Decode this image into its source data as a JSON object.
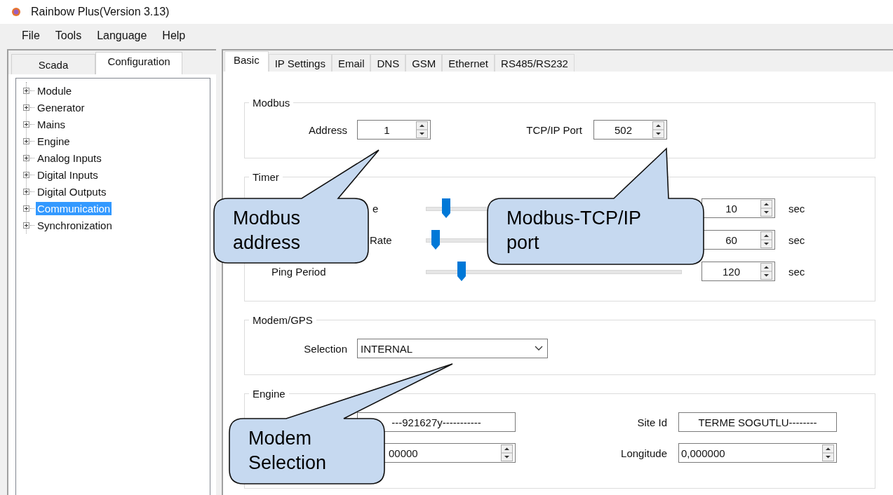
{
  "window": {
    "title": "Rainbow Plus(Version 3.13)"
  },
  "menu": [
    "File",
    "Tools",
    "Language",
    "Help"
  ],
  "left_tabs": [
    {
      "label": "Scada",
      "selected": false
    },
    {
      "label": "Configuration",
      "selected": true
    }
  ],
  "tree": [
    {
      "label": "Module",
      "expanded": false,
      "selected": false
    },
    {
      "label": "Generator",
      "expanded": false,
      "selected": false
    },
    {
      "label": "Mains",
      "expanded": false,
      "selected": false
    },
    {
      "label": "Engine",
      "expanded": false,
      "selected": false
    },
    {
      "label": "Analog Inputs",
      "expanded": false,
      "selected": false
    },
    {
      "label": "Digital Inputs",
      "expanded": false,
      "selected": false
    },
    {
      "label": "Digital Outputs",
      "expanded": false,
      "selected": false
    },
    {
      "label": "Communication",
      "expanded": false,
      "selected": true
    },
    {
      "label": "Synchronization",
      "expanded": false,
      "selected": false
    }
  ],
  "tabs": [
    {
      "label": "Basic",
      "selected": true
    },
    {
      "label": "IP Settings",
      "selected": false
    },
    {
      "label": "Email",
      "selected": false
    },
    {
      "label": "DNS",
      "selected": false
    },
    {
      "label": "GSM",
      "selected": false
    },
    {
      "label": "Ethernet",
      "selected": false
    },
    {
      "label": "RS485/RS232",
      "selected": false
    }
  ],
  "modbus": {
    "title": "Modbus",
    "address_label": "Address",
    "address": "1",
    "port_label": "TCP/IP Port",
    "port": "502"
  },
  "timer": {
    "title": "Timer",
    "rows": [
      {
        "label": "e",
        "level": 0.06,
        "value": "10",
        "unit": "sec"
      },
      {
        "label": "Rate",
        "level": 0.02,
        "value": "60",
        "unit": "sec"
      },
      {
        "label": "Ping Period",
        "level": 0.12,
        "value": "120",
        "unit": "sec"
      }
    ]
  },
  "modem": {
    "title": "Modem/GPS",
    "selection_label": "Selection",
    "selection": "INTERNAL"
  },
  "engine": {
    "title": "Engine",
    "id_value": "---921627y-----------",
    "site_label": "Site Id",
    "site_value": "TERME SOGUTLU--------",
    "lat_value": "00000",
    "long_label": "Longitude",
    "long_value": "0,000000"
  },
  "callouts": [
    {
      "text": "Modbus address"
    },
    {
      "text": "Modbus-TCP/IP port"
    },
    {
      "text": "Modem Selection"
    }
  ]
}
